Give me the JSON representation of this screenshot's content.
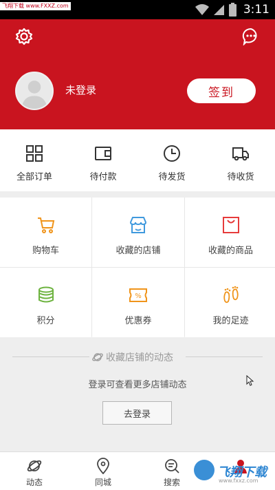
{
  "status_bar": {
    "watermark_tag": "飞翔下载 www.FXXZ.com",
    "time": "3:11"
  },
  "header": {
    "login_status": "未登录",
    "checkin_label": "签到",
    "accent_color": "#c9141f"
  },
  "orders": [
    {
      "label": "全部订单",
      "icon": "grid-icon"
    },
    {
      "label": "待付款",
      "icon": "wallet-icon"
    },
    {
      "label": "待发货",
      "icon": "clock-icon"
    },
    {
      "label": "待收货",
      "icon": "truck-icon"
    }
  ],
  "services": [
    {
      "label": "购物车",
      "icon": "cart-icon",
      "color": "#f0941a"
    },
    {
      "label": "收藏的店铺",
      "icon": "store-icon",
      "color": "#3f99dd"
    },
    {
      "label": "收藏的商品",
      "icon": "bag-icon",
      "color": "#e63b3b"
    },
    {
      "label": "积分",
      "icon": "coins-icon",
      "color": "#6db33f"
    },
    {
      "label": "优惠券",
      "icon": "coupon-icon",
      "color": "#f0941a"
    },
    {
      "label": "我的足迹",
      "icon": "footprint-icon",
      "color": "#f0941a"
    }
  ],
  "dynamics": {
    "title": "收藏店铺的动态",
    "description": "登录可查看更多店铺动态",
    "login_button": "去登录"
  },
  "bottom_nav": [
    {
      "label": "动态",
      "icon": "planet-icon"
    },
    {
      "label": "同城",
      "icon": "location-pin-icon"
    },
    {
      "label": "搜索",
      "icon": "search-icon"
    }
  ],
  "watermark": {
    "text": "飞翔下载",
    "url": "www.fxxz.com"
  }
}
